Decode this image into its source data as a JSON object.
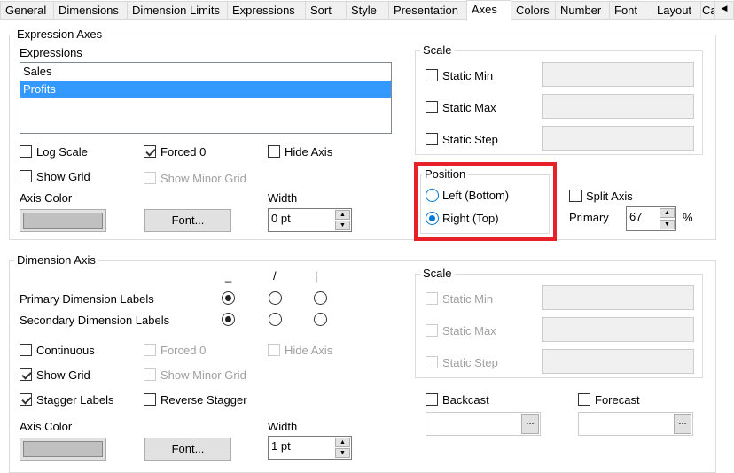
{
  "tabs": [
    "General",
    "Dimensions",
    "Dimension Limits",
    "Expressions",
    "Sort",
    "Style",
    "Presentation",
    "Axes",
    "Colors",
    "Number",
    "Font",
    "Layout",
    "Ca"
  ],
  "active_tab": "Axes",
  "expression_axes": {
    "title": "Expression Axes",
    "expressions_label": "Expressions",
    "expressions": [
      "Sales",
      "Profits"
    ],
    "selected": "Profits",
    "log_scale": "Log Scale",
    "forced0": "Forced 0",
    "hide_axis": "Hide Axis",
    "show_grid": "Show Grid",
    "show_minor_grid": "Show Minor Grid",
    "axis_color": "Axis Color",
    "font_button": "Font...",
    "width_label": "Width",
    "width_value": "0 pt",
    "scale": {
      "title": "Scale",
      "static_min": "Static Min",
      "static_max": "Static Max",
      "static_step": "Static Step"
    },
    "position": {
      "title": "Position",
      "left": "Left (Bottom)",
      "right": "Right (Top)",
      "selected": "Right (Top)"
    },
    "split_axis": "Split Axis",
    "primary_label": "Primary",
    "primary_value": "67",
    "percent": "%"
  },
  "dimension_axis": {
    "title": "Dimension Axis",
    "orient_headers": [
      "_",
      "/",
      "|"
    ],
    "primary_labels": "Primary Dimension Labels",
    "secondary_labels": "Secondary Dimension Labels",
    "continuous": "Continuous",
    "forced0": "Forced 0",
    "hide_axis": "Hide Axis",
    "show_grid": "Show Grid",
    "show_minor_grid": "Show Minor Grid",
    "stagger_labels": "Stagger Labels",
    "reverse_stagger": "Reverse Stagger",
    "axis_color": "Axis Color",
    "font_button": "Font...",
    "width_label": "Width",
    "width_value": "1 pt",
    "scale": {
      "title": "Scale",
      "static_min": "Static Min",
      "static_max": "Static Max",
      "static_step": "Static Step"
    },
    "backcast": "Backcast",
    "forecast": "Forecast",
    "ellipsis": "..."
  },
  "highlight_color": "#e8202a"
}
